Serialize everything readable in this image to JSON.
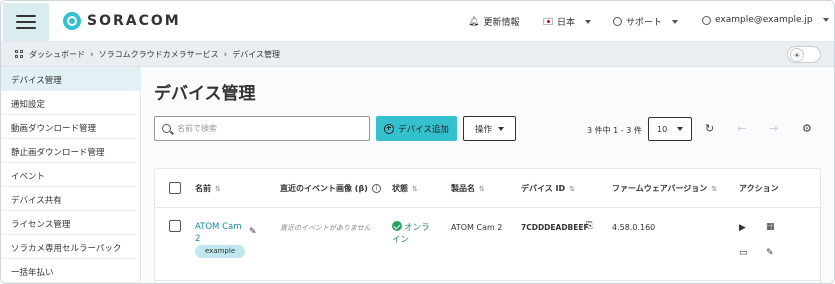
{
  "header": {
    "brand": "SORACOM",
    "whats_new": "更新情報",
    "language": "日本",
    "support": "サポート",
    "account_email": "example@example.jp"
  },
  "breadcrumb": {
    "items": [
      "ダッシュボード",
      "ソラコムクラウドカメラサービス",
      "デバイス管理"
    ]
  },
  "sidebar": {
    "items": [
      {
        "label": "デバイス管理",
        "active": true
      },
      {
        "label": "通知設定",
        "active": false
      },
      {
        "label": "動画ダウンロード管理",
        "active": false
      },
      {
        "label": "静止画ダウンロード管理",
        "active": false
      },
      {
        "label": "イベント",
        "active": false
      },
      {
        "label": "デバイス共有",
        "active": false
      },
      {
        "label": "ライセンス管理",
        "active": false
      },
      {
        "label": "ソラカメ専用セルラーパック",
        "active": false
      },
      {
        "label": "一括年払い",
        "active": false
      }
    ]
  },
  "main": {
    "title": "デバイス管理",
    "search_placeholder": "名前で検索",
    "add_device_label": "デバイス追加",
    "operations_label": "操作",
    "pagination_text": "3 件中 1 - 3 件",
    "per_page": "10"
  },
  "table": {
    "columns": {
      "name": "名前",
      "latest_event_image": "直近のイベント画像 (β)",
      "status": "状態",
      "product": "製品名",
      "device_id": "デバイス ID",
      "firmware": "ファームウェアバージョン",
      "actions": "アクション"
    },
    "rows": [
      {
        "name_line1": "ATOM Cam",
        "name_line2": "2",
        "tag": "example",
        "latest_event": "直近のイベントがありません",
        "status_line1": "オンラ",
        "status_line2": "イン",
        "product": "ATOM Cam 2",
        "device_id": "7CDDDEADBEEF",
        "firmware": "4.58.0.160"
      }
    ]
  },
  "colors": {
    "accent": "#34c0cd",
    "link": "#1e8a96",
    "online": "#2aa15c",
    "sidebar_active": "#e2f1f5"
  }
}
